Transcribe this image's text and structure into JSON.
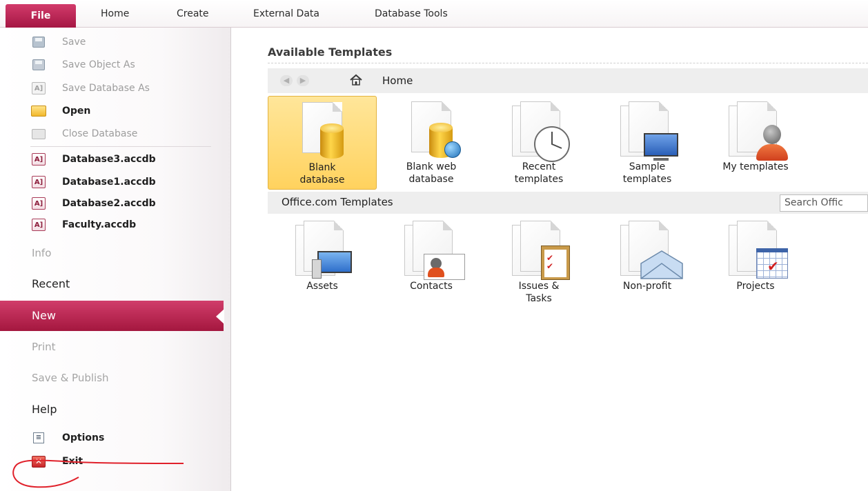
{
  "tabs": {
    "file": "File",
    "home": "Home",
    "create": "Create",
    "external_data": "External Data",
    "database_tools": "Database Tools"
  },
  "backstage": {
    "commands": {
      "save": "Save",
      "save_object_as": "Save Object As",
      "save_database_as": "Save Database As",
      "open": "Open",
      "close_database": "Close Database"
    },
    "recent_files": [
      "Database3.accdb",
      "Database1.accdb",
      "Database2.accdb",
      "Faculty.accdb"
    ],
    "sections": {
      "info": "Info",
      "recent": "Recent",
      "new": "New",
      "print": "Print",
      "save_publish": "Save & Publish",
      "help": "Help"
    },
    "options": "Options",
    "exit": "Exit"
  },
  "content": {
    "heading": "Available Templates",
    "nav_home": "Home",
    "templates": [
      {
        "line1": "Blank",
        "line2": "database"
      },
      {
        "line1": "Blank web",
        "line2": "database"
      },
      {
        "line1": "Recent",
        "line2": "templates"
      },
      {
        "line1": "Sample",
        "line2": "templates"
      },
      {
        "line1": "My templates",
        "line2": ""
      }
    ],
    "office_heading": "Office.com Templates",
    "search_placeholder": "Search Offic",
    "office_templates": [
      {
        "line1": "Assets",
        "line2": ""
      },
      {
        "line1": "Contacts",
        "line2": ""
      },
      {
        "line1": "Issues &",
        "line2": "Tasks"
      },
      {
        "line1": "Non-profit",
        "line2": ""
      },
      {
        "line1": "Projects",
        "line2": ""
      }
    ]
  },
  "colors": {
    "accent": "#b7204f",
    "selected_tile": "#ffd25e",
    "annotation": "#e0202a"
  }
}
